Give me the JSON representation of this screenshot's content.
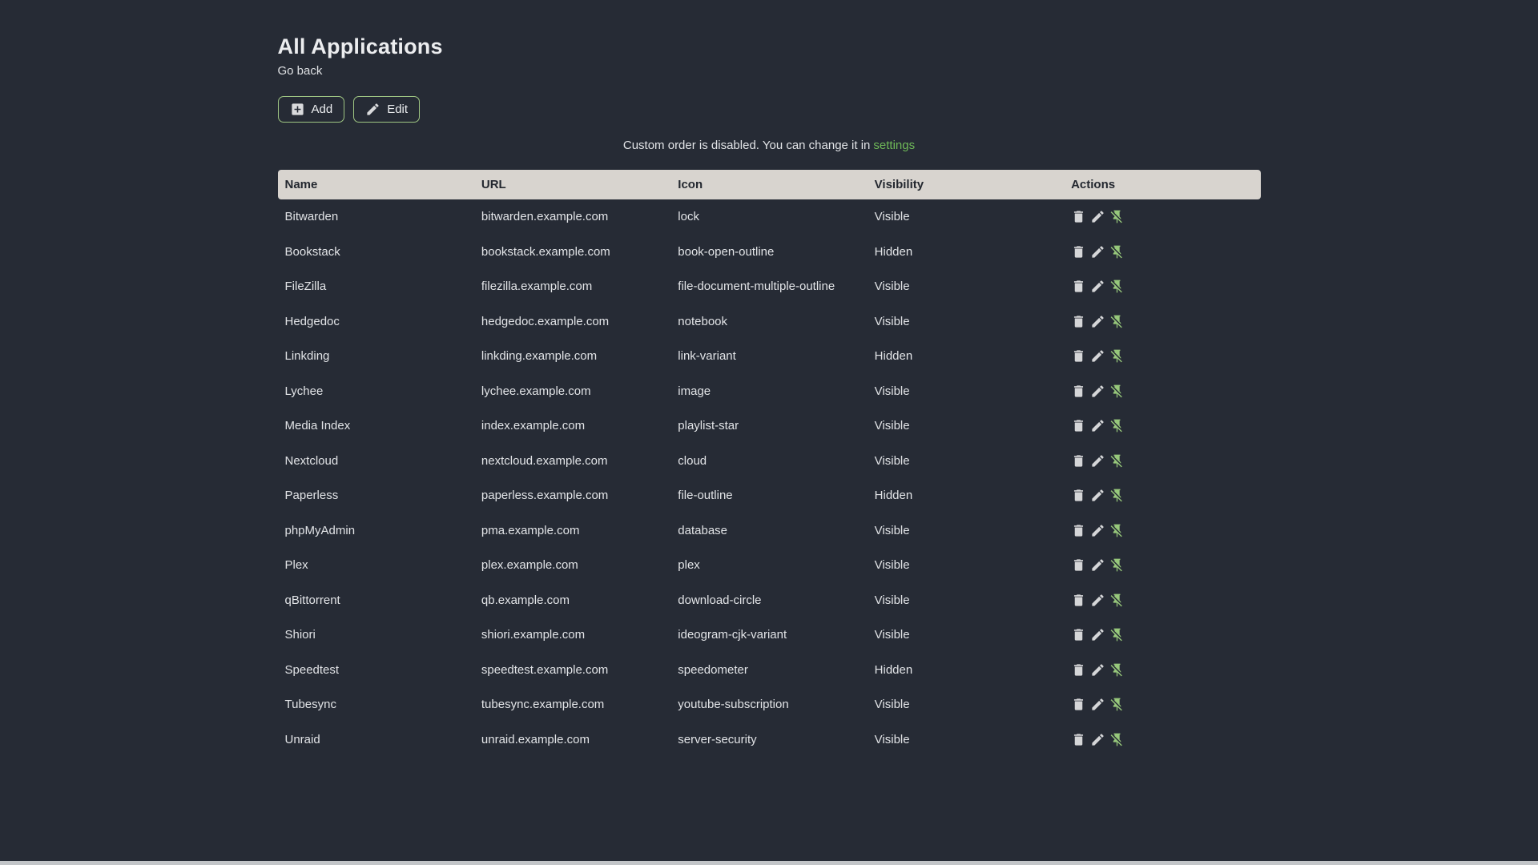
{
  "page": {
    "title": "All Applications",
    "back_label": "Go back"
  },
  "toolbar": {
    "add_label": "Add",
    "edit_label": "Edit"
  },
  "notice": {
    "text": "Custom order is disabled. You can change it in",
    "link_label": "settings"
  },
  "table": {
    "headers": [
      "Name",
      "URL",
      "Icon",
      "Visibility",
      "Actions"
    ],
    "row_actions": [
      "delete",
      "edit",
      "unpin"
    ],
    "rows": [
      {
        "name": "Bitwarden",
        "url": "bitwarden.example.com",
        "icon": "lock",
        "visibility": "Visible"
      },
      {
        "name": "Bookstack",
        "url": "bookstack.example.com",
        "icon": "book-open-outline",
        "visibility": "Hidden"
      },
      {
        "name": "FileZilla",
        "url": "filezilla.example.com",
        "icon": "file-document-multiple-outline",
        "visibility": "Visible"
      },
      {
        "name": "Hedgedoc",
        "url": "hedgedoc.example.com",
        "icon": "notebook",
        "visibility": "Visible"
      },
      {
        "name": "Linkding",
        "url": "linkding.example.com",
        "icon": "link-variant",
        "visibility": "Hidden"
      },
      {
        "name": "Lychee",
        "url": "lychee.example.com",
        "icon": "image",
        "visibility": "Visible"
      },
      {
        "name": "Media Index",
        "url": "index.example.com",
        "icon": "playlist-star",
        "visibility": "Visible"
      },
      {
        "name": "Nextcloud",
        "url": "nextcloud.example.com",
        "icon": "cloud",
        "visibility": "Visible"
      },
      {
        "name": "Paperless",
        "url": "paperless.example.com",
        "icon": "file-outline",
        "visibility": "Hidden"
      },
      {
        "name": "phpMyAdmin",
        "url": "pma.example.com",
        "icon": "database",
        "visibility": "Visible"
      },
      {
        "name": "Plex",
        "url": "plex.example.com",
        "icon": "plex",
        "visibility": "Visible"
      },
      {
        "name": "qBittorrent",
        "url": "qb.example.com",
        "icon": "download-circle",
        "visibility": "Visible"
      },
      {
        "name": "Shiori",
        "url": "shiori.example.com",
        "icon": "ideogram-cjk-variant",
        "visibility": "Visible"
      },
      {
        "name": "Speedtest",
        "url": "speedtest.example.com",
        "icon": "speedometer",
        "visibility": "Hidden"
      },
      {
        "name": "Tubesync",
        "url": "tubesync.example.com",
        "icon": "youtube-subscription",
        "visibility": "Visible"
      },
      {
        "name": "Unraid",
        "url": "unraid.example.com",
        "icon": "server-security",
        "visibility": "Visible"
      }
    ]
  },
  "colors": {
    "background": "#262B35",
    "link_green": "#6FBA58",
    "button_border_green": "#9FC683",
    "pin_green": "#97C87B",
    "header_bg": "#D8D4CF",
    "header_text": "#23272F",
    "body_text": "#E2E4E7",
    "scrollbar": "#C2C5C8"
  }
}
